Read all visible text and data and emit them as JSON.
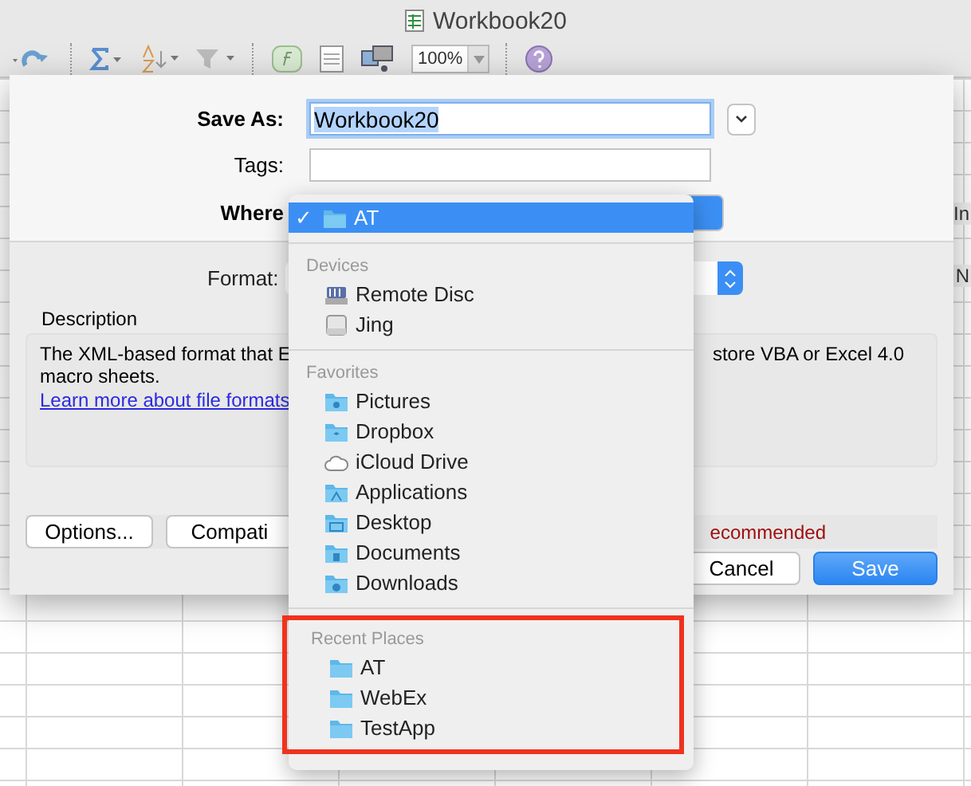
{
  "window": {
    "title": "Workbook20"
  },
  "toolbar": {
    "zoom": "100%"
  },
  "sheet_edge": {
    "ribbon_text": "In",
    "column_header": "N"
  },
  "dialog": {
    "save_as": {
      "label": "Save As:",
      "value": "Workbook20"
    },
    "tags": {
      "label": "Tags:"
    },
    "where": {
      "label": "Where"
    },
    "format": {
      "label": "Format:"
    },
    "description": {
      "heading": "Description",
      "lines_left": [
        "The XML-based format that E",
        "macro sheets."
      ],
      "text_right": "store VBA or Excel 4.0",
      "link": "Learn more about file formats"
    },
    "buttons_left": [
      "Options...",
      "Compati"
    ],
    "warning": "ecommended",
    "cancel": "Cancel",
    "save": "Save"
  },
  "menu": {
    "current": {
      "check": "✓",
      "label": "AT",
      "selected": true
    },
    "sections": [
      {
        "heading": "Devices",
        "highlighted": false,
        "items": [
          {
            "label": "Remote Disc",
            "kind": "disc"
          },
          {
            "label": "Jing",
            "kind": "drive"
          }
        ]
      },
      {
        "heading": "Favorites",
        "highlighted": false,
        "items": [
          {
            "label": "Pictures",
            "kind": "pictures"
          },
          {
            "label": "Dropbox",
            "kind": "dropbox"
          },
          {
            "label": "iCloud Drive",
            "kind": "cloud"
          },
          {
            "label": "Applications",
            "kind": "applications"
          },
          {
            "label": "Desktop",
            "kind": "desktop"
          },
          {
            "label": "Documents",
            "kind": "documents"
          },
          {
            "label": "Downloads",
            "kind": "downloads"
          }
        ]
      },
      {
        "heading": "Recent Places",
        "highlighted": true,
        "items": [
          {
            "label": "AT",
            "kind": "folder"
          },
          {
            "label": "WebEx",
            "kind": "folder"
          },
          {
            "label": "TestApp",
            "kind": "folder"
          }
        ]
      }
    ]
  }
}
